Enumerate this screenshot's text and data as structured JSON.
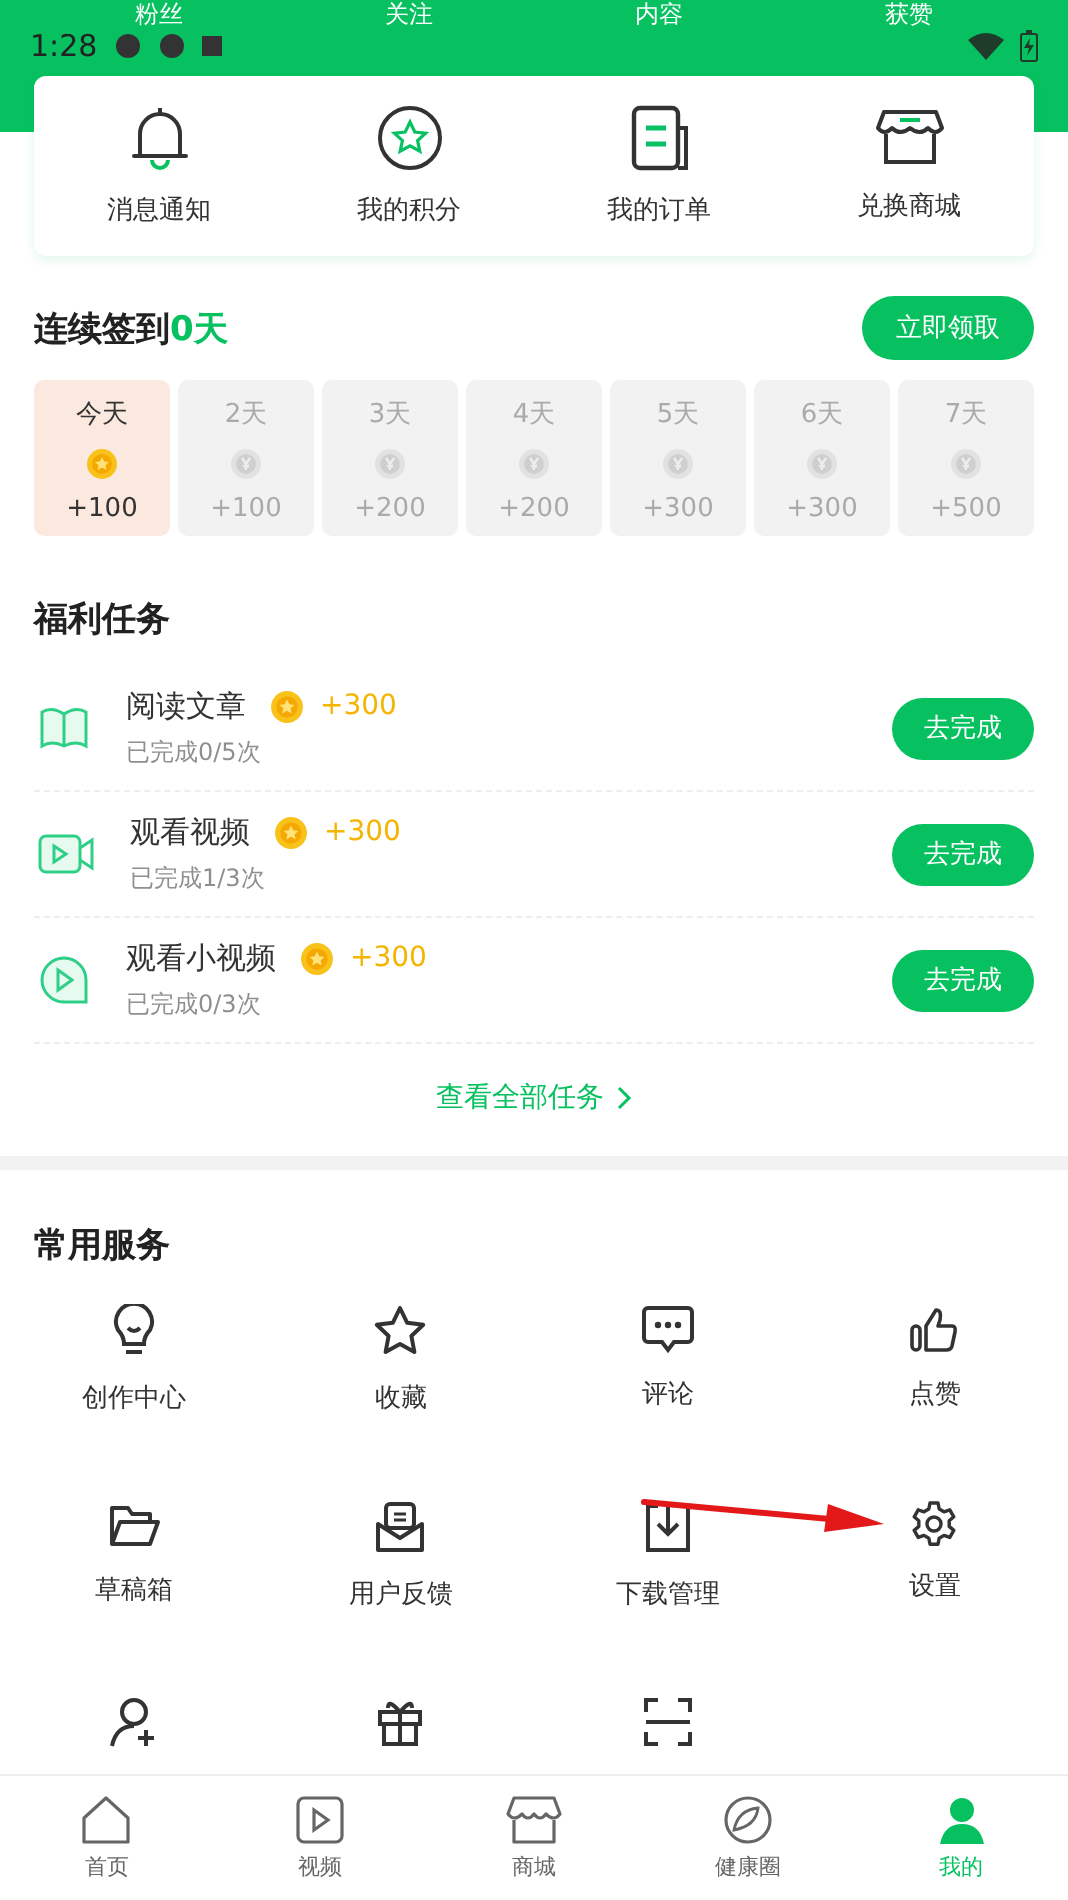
{
  "header": {
    "stats": [
      "粉丝",
      "关注",
      "内容",
      "获赞"
    ],
    "status_time": "1:28"
  },
  "quick_links": [
    {
      "label": "消息通知"
    },
    {
      "label": "我的积分"
    },
    {
      "label": "我的订单"
    },
    {
      "label": "兑换商城"
    }
  ],
  "signin": {
    "title": "连续签到**0天**",
    "button": "立即领取",
    "days": [
      {
        "label": "今天",
        "points": "+100",
        "selected": true
      },
      {
        "label": "2天",
        "points": "+100",
        "selected": false
      },
      {
        "label": "3天",
        "points": "+200",
        "selected": false
      },
      {
        "label": "4天",
        "points": "+200",
        "selected": false
      },
      {
        "label": "5天",
        "points": "+300",
        "selected": false
      },
      {
        "label": "6天",
        "points": "+300",
        "selected": false
      },
      {
        "label": "7天",
        "points": "+500",
        "selected": false
      }
    ]
  },
  "tasks": {
    "title": "福利任务",
    "items": [
      {
        "name": "阅读文章",
        "reward": "+300",
        "progress": "已完成0/5次",
        "button": "去完成"
      },
      {
        "name": "观看视频",
        "reward": "+300",
        "progress": "已完成1/3次",
        "button": "去完成"
      },
      {
        "name": "观看小视频",
        "reward": "+300",
        "progress": "已完成0/3次",
        "button": "去完成"
      }
    ],
    "view_all": "查看全部任务"
  },
  "services": {
    "title": "常用服务",
    "items": [
      {
        "kind": "labeled",
        "label": "创作中心"
      },
      {
        "kind": "labeled",
        "label": "收藏"
      },
      {
        "kind": "labeled",
        "label": "评论"
      },
      {
        "kind": "labeled",
        "label": "点赞"
      },
      {
        "kind": "labeled",
        "label": "草稿箱"
      },
      {
        "kind": "labeled",
        "label": "用户反馈"
      },
      {
        "kind": "labeled",
        "label": "下载管理"
      },
      {
        "kind": "labeled",
        "label": "设置"
      },
      {
        "kind": "icon_only"
      },
      {
        "kind": "icon_only"
      },
      {
        "kind": "icon_only"
      }
    ]
  },
  "bottom_nav": [
    {
      "label": "首页",
      "selected": false
    },
    {
      "label": "视频",
      "selected": false
    },
    {
      "label": "商城",
      "selected": false
    },
    {
      "label": "健康圈",
      "selected": false
    },
    {
      "label": "我的",
      "selected": true
    }
  ]
}
